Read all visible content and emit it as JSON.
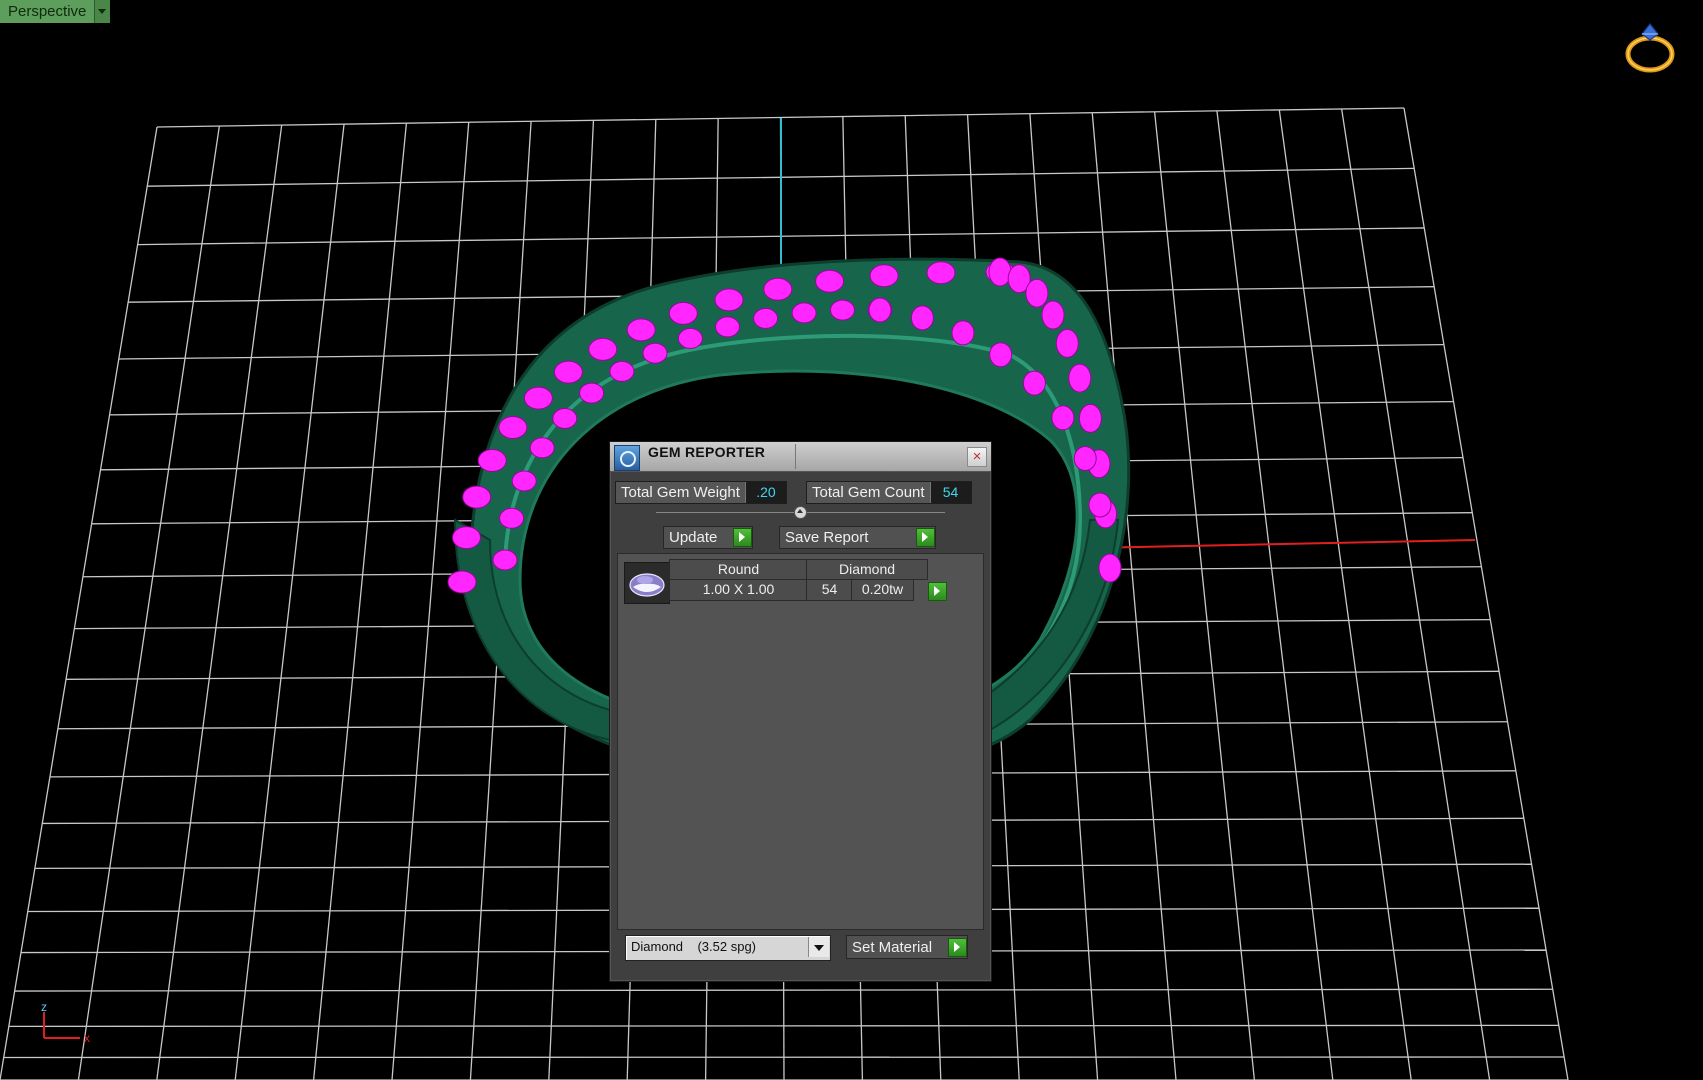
{
  "viewport": {
    "view_label": "Perspective",
    "grid_color": "#c8c8c8",
    "ring_color": "#17654b",
    "gem_color": "#ff26ff",
    "axis_y_color": "#2fbfd0",
    "axis_x_color": "#e02020",
    "axis_indicator": {
      "z_label": "z",
      "x_label": "x"
    }
  },
  "gem_reporter": {
    "title": "GEM REPORTER",
    "close_label": "×",
    "total_weight_label": "Total Gem Weight",
    "total_weight_value": ".20",
    "total_count_label": "Total Gem Count",
    "total_count_value": "54",
    "update_label": "Update",
    "save_report_label": "Save Report",
    "rows": [
      {
        "shape": "Round",
        "material": "Diamond",
        "size": "1.00 X 1.00",
        "count": "54",
        "weight": "0.20tw"
      }
    ],
    "material_select": "Diamond    (3.52 spg)",
    "set_material_label": "Set Material"
  }
}
